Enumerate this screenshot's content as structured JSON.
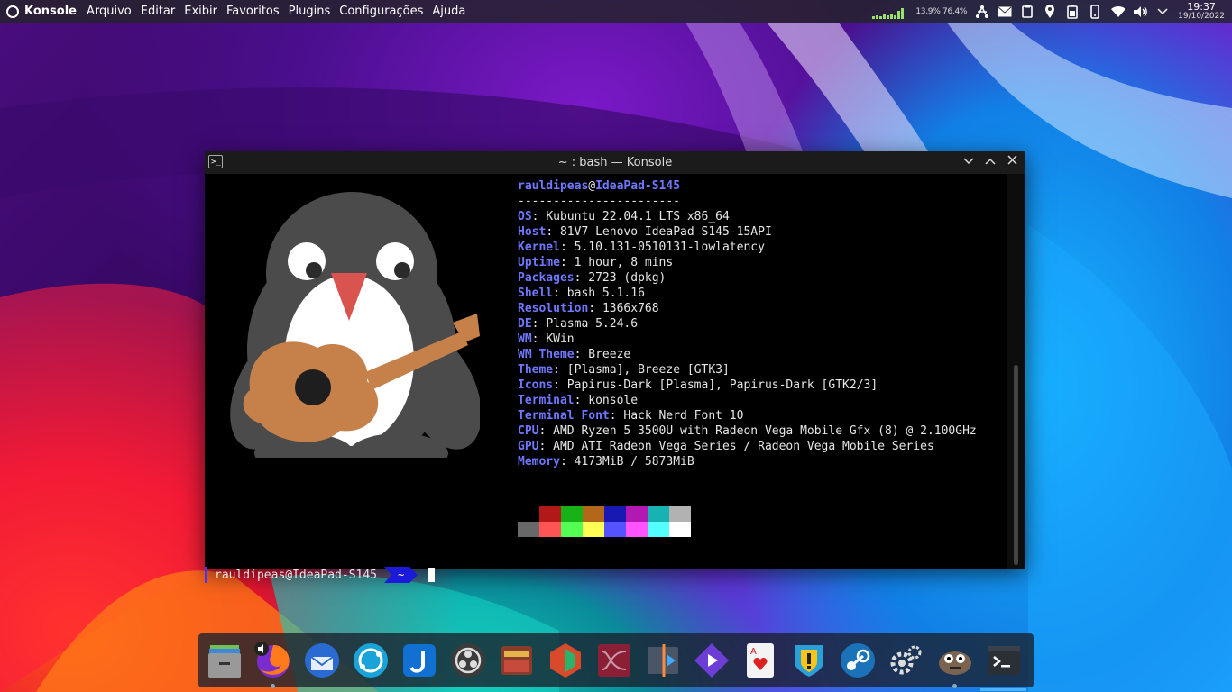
{
  "topbar": {
    "app_name": "Konsole",
    "menu": [
      "Arquivo",
      "Editar",
      "Exibir",
      "Favoritos",
      "Plugins",
      "Configurações",
      "Ajuda"
    ],
    "stats": "13,9% 76,4%",
    "clock_time": "19:37",
    "clock_date": "19/10/2022",
    "tray_icons": [
      "system-monitor",
      "network-graph-icon",
      "mail-icon",
      "clipboard-icon",
      "location-icon",
      "battery-icon",
      "phone-icon",
      "wifi-icon",
      "volume-icon",
      "expand-icon"
    ]
  },
  "window": {
    "title": "~ : bash — Konsole",
    "icon_text": ">_",
    "buttons": [
      "minimize",
      "maximize",
      "close"
    ]
  },
  "neofetch": {
    "userhost_user": "rauldipeas",
    "userhost_at": "@",
    "userhost_host": "IdeaPad-S145",
    "separator": "-----------------------",
    "fields": [
      {
        "key": "OS",
        "value": "Kubuntu 22.04.1 LTS x86_64"
      },
      {
        "key": "Host",
        "value": "81V7 Lenovo IdeaPad S145-15API"
      },
      {
        "key": "Kernel",
        "value": "5.10.131-0510131-lowlatency"
      },
      {
        "key": "Uptime",
        "value": "1 hour, 8 mins"
      },
      {
        "key": "Packages",
        "value": "2723 (dpkg)"
      },
      {
        "key": "Shell",
        "value": "bash 5.1.16"
      },
      {
        "key": "Resolution",
        "value": "1366x768"
      },
      {
        "key": "DE",
        "value": "Plasma 5.24.6"
      },
      {
        "key": "WM",
        "value": "KWin"
      },
      {
        "key": "WM Theme",
        "value": "Breeze"
      },
      {
        "key": "Theme",
        "value": "[Plasma], Breeze [GTK3]"
      },
      {
        "key": "Icons",
        "value": "Papirus-Dark [Plasma], Papirus-Dark [GTK2/3]"
      },
      {
        "key": "Terminal",
        "value": "konsole"
      },
      {
        "key": "Terminal Font",
        "value": "Hack Nerd Font 10"
      },
      {
        "key": "CPU",
        "value": "AMD Ryzen 5 3500U with Radeon Vega Mobile Gfx (8) @ 2.100GHz"
      },
      {
        "key": "GPU",
        "value": "AMD ATI Radeon Vega Series / Radeon Vega Mobile Series"
      },
      {
        "key": "Memory",
        "value": "4173MiB / 5873MiB"
      }
    ],
    "palette_dark": [
      "#000000",
      "#b21818",
      "#18b218",
      "#b26818",
      "#1818b2",
      "#b218b2",
      "#18b2b2",
      "#b2b2b2"
    ],
    "palette_light": [
      "#686868",
      "#ff5454",
      "#54ff54",
      "#ffff54",
      "#5454ff",
      "#ff54ff",
      "#54ffff",
      "#ffffff"
    ]
  },
  "prompt": {
    "userhost": "rauldipeas@IdeaPad-S145",
    "cwd": "~"
  },
  "dock": {
    "items": [
      {
        "name": "files-icon",
        "label": "Files"
      },
      {
        "name": "firefox-icon",
        "label": "Firefox"
      },
      {
        "name": "thunderbird-icon",
        "label": "Thunderbird"
      },
      {
        "name": "network-icon",
        "label": "Network"
      },
      {
        "name": "joplin-icon",
        "label": "Joplin"
      },
      {
        "name": "obs-icon",
        "label": "OBS"
      },
      {
        "name": "gpu-viewer-icon",
        "label": "GPU"
      },
      {
        "name": "reaper-icon",
        "label": "Reaper"
      },
      {
        "name": "audio-editor-icon",
        "label": "Audio"
      },
      {
        "name": "video-editor-icon",
        "label": "Video"
      },
      {
        "name": "media-player-icon",
        "label": "Player"
      },
      {
        "name": "cards-icon",
        "label": "Cards"
      },
      {
        "name": "alert-shield-icon",
        "label": "Shield"
      },
      {
        "name": "steam-icon",
        "label": "Steam"
      },
      {
        "name": "settings-icon",
        "label": "Settings"
      },
      {
        "name": "gimp-icon",
        "label": "GIMP"
      },
      {
        "name": "konsole-icon",
        "label": "Konsole"
      }
    ]
  }
}
